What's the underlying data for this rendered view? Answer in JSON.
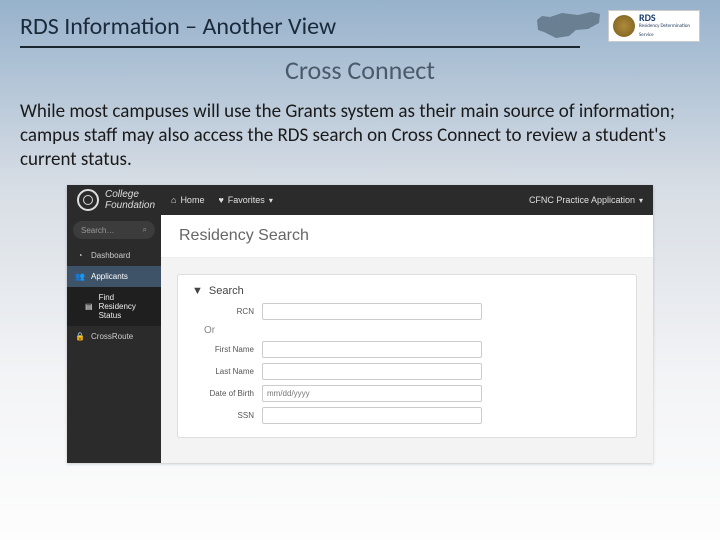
{
  "header": {
    "title": "RDS Information – Another View",
    "logo_primary": "RDS",
    "logo_secondary": "Residency Determination Service"
  },
  "subtitle": "Cross Connect",
  "body": "While most campuses will use the Grants system as their main source of information; campus staff may also access the RDS search on Cross Connect to review a student's current status.",
  "app": {
    "brand_line1": "College",
    "brand_line2": "Foundation",
    "topnav": {
      "home": "Home",
      "favorites": "Favorites",
      "right": "CFNC Practice Application"
    },
    "sidebar": {
      "search_placeholder": "Search…",
      "items": [
        {
          "label": "Dashboard"
        },
        {
          "label": "Applicants"
        },
        {
          "label": "Find Residency Status"
        },
        {
          "label": "CrossRoute"
        }
      ]
    },
    "main": {
      "title": "Residency Search",
      "panel_title": "Search",
      "or": "Or",
      "fields": {
        "rcn_label": "RCN",
        "first_label": "First Name",
        "last_label": "Last Name",
        "dob_label": "Date of Birth",
        "dob_placeholder": "mm/dd/yyyy",
        "ssn_label": "SSN"
      }
    }
  }
}
